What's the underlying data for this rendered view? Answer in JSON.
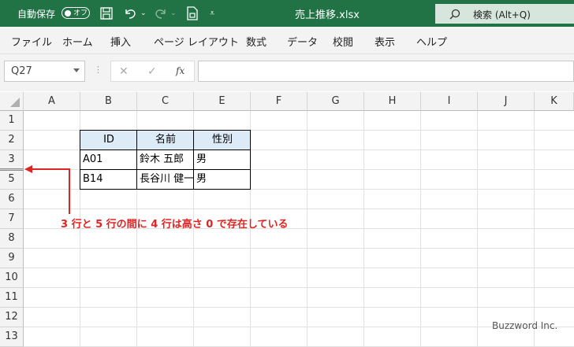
{
  "titlebar": {
    "autosave_label": "自動保存",
    "autosave_state": "オフ",
    "file_name": "売上推移.xlsx",
    "search_placeholder": "検索 (Alt+Q)"
  },
  "ribbon_tabs": [
    "ファイル",
    "ホーム",
    "挿入",
    "ページ レイアウト",
    "数式",
    "データ",
    "校閲",
    "表示",
    "ヘルプ"
  ],
  "formula_bar": {
    "name_box": "Q27",
    "fx": "fx",
    "value": ""
  },
  "columns": [
    "A",
    "B",
    "C",
    "D",
    "E",
    "F",
    "G",
    "H",
    "I",
    "J",
    "K"
  ],
  "rows": [
    "1",
    "2",
    "3",
    "5",
    "6",
    "7",
    "8",
    "9",
    "10",
    "11",
    "12",
    "13"
  ],
  "table": {
    "headers": [
      "ID",
      "名前",
      "性別"
    ],
    "rows": [
      [
        "A01",
        "鈴木 五郎",
        "男"
      ],
      [
        "B14",
        "長谷川 健一",
        "男"
      ]
    ]
  },
  "annotation": "3 行と 5 行の間に 4 行は高さ 0 で存在している",
  "watermark": "Buzzword Inc.",
  "colors": {
    "title_bar": "#217346",
    "header_fill": "#ddebf7",
    "annotation": "#e02424"
  }
}
